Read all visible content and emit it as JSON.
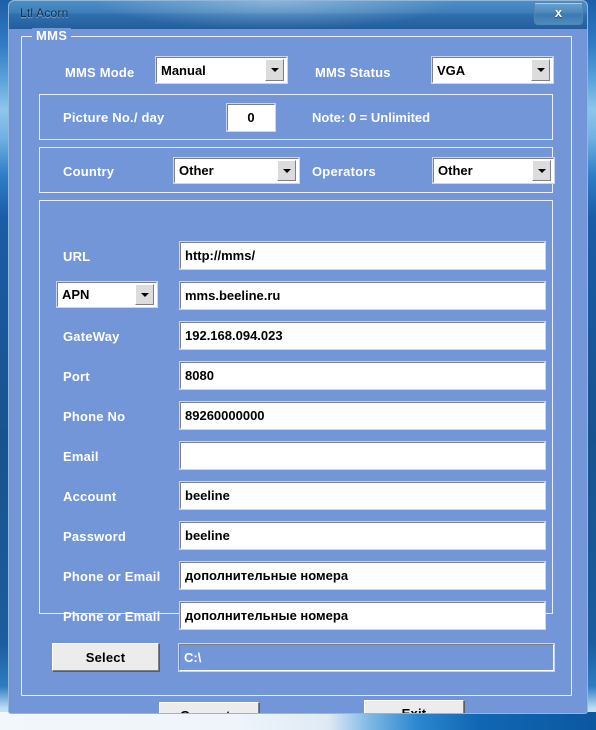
{
  "window": {
    "title": "Ltl Acorn",
    "close_label": "x"
  },
  "group": {
    "label": "MMS"
  },
  "mms": {
    "mode_label": "MMS Mode",
    "mode_value": "Manual",
    "status_label": "MMS Status",
    "status_value": "VGA"
  },
  "picture": {
    "label": "Picture No./ day",
    "value": "0",
    "note": "Note: 0 = Unlimited"
  },
  "region": {
    "country_label": "Country",
    "country_value": "Other",
    "operators_label": "Operators",
    "operators_value": "Other"
  },
  "fields": [
    {
      "label": "URL",
      "value": "http://mms/",
      "type": "text"
    },
    {
      "label": "APN",
      "value": "mms.beeline.ru",
      "type": "combo"
    },
    {
      "label": "GateWay",
      "value": "192.168.094.023",
      "type": "text"
    },
    {
      "label": "Port",
      "value": "8080",
      "type": "text"
    },
    {
      "label": "Phone No",
      "value": "89260000000",
      "type": "text"
    },
    {
      "label": "Email",
      "value": "",
      "type": "text"
    },
    {
      "label": "Account",
      "value": "beeline",
      "type": "text"
    },
    {
      "label": "Password",
      "value": "beeline",
      "type": "text"
    },
    {
      "label": "Phone or Email",
      "value": "дополнительные номера",
      "type": "text"
    },
    {
      "label": "Phone or Email",
      "value": "дополнительные номера",
      "type": "text"
    }
  ],
  "path": {
    "select_label": "Select",
    "value": "C:\\"
  },
  "actions": {
    "generate_label": "Generate",
    "exit_label": "Exit"
  },
  "colors": {
    "dialog_bg": "#7296d8",
    "group_border": "#e9eef8",
    "label_text": "#ffffff",
    "titlebar_start": "#4d8ec4",
    "titlebar_end": "#255f9e"
  }
}
